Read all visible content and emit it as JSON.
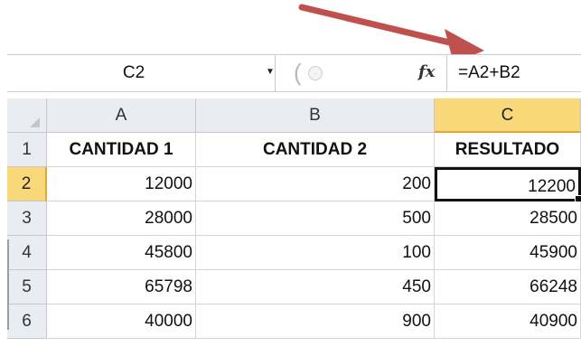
{
  "formula_bar": {
    "name_box": "C2",
    "formula": "=A2+B2",
    "fx_label": "fx",
    "arrow_color": "#c0504d"
  },
  "sheet": {
    "columns": [
      "A",
      "B",
      "C"
    ],
    "active_column": "C",
    "active_row": "2",
    "rows": [
      {
        "num": "1",
        "cells": [
          "CANTIDAD 1",
          "CANTIDAD 2",
          "RESULTADO"
        ]
      },
      {
        "num": "2",
        "cells": [
          "12000",
          "200",
          "12200"
        ]
      },
      {
        "num": "3",
        "cells": [
          "28000",
          "500",
          "28500"
        ]
      },
      {
        "num": "4",
        "cells": [
          "45800",
          "100",
          "45900"
        ]
      },
      {
        "num": "5",
        "cells": [
          "65798",
          "450",
          "66248"
        ]
      },
      {
        "num": "6",
        "cells": [
          "40000",
          "900",
          "40900"
        ]
      }
    ],
    "selected_cell": "C2",
    "header_highlight_color": "#f9d87a"
  }
}
